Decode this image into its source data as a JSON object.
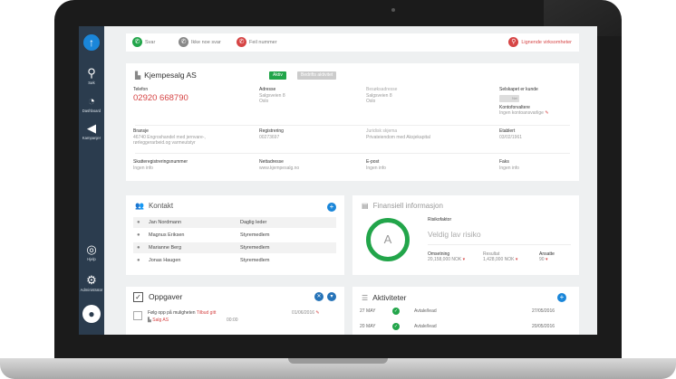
{
  "topbar": {
    "answer": "Svar",
    "no_answer": "Ikke noe svar",
    "wrong_number": "Feil nummer",
    "similar": "Lignende virksomheter"
  },
  "sidebar": {
    "search": "Søk",
    "dashboard": "Dashboard",
    "campaigns": "Kampanjer",
    "help": "Hjelp",
    "admin": "Administrator"
  },
  "company": {
    "name": "Kjempesalg AS",
    "status": "Aktiv",
    "status2": "Bedrifts aktivitet",
    "phone_label": "Telefon",
    "phone": "02920 668790",
    "address_label": "Adresse",
    "address1": "Salgsveien 8",
    "address2": "Oslo",
    "business_address_label": "Besøksadresse",
    "business_address1": "Salgsveien 8",
    "business_address2": "Oslo",
    "is_customer_label": "Selskapet er kunde",
    "is_customer_value": "Nei",
    "account_manager_label": "Kontoforvaltere",
    "account_manager_value": "Ingen kontoansvarlige",
    "industry_label": "Bransje",
    "industry_value1": "46740 Engroshandel med jernvare-,",
    "industry_value2": "rørleggerarbeid.og varmeutstyr",
    "registration_label": "Registrering",
    "registration_value": "00273697",
    "legal_form_label": "Juridisk skjema",
    "legal_form_value": "Privateiendom med Aksjekapital",
    "established_label": "Etablert",
    "established_value": "03/02/1961",
    "tax_label": "Skatteregistreringsnummer",
    "tax_value": "Ingen info",
    "website_label": "Nettadresse",
    "website_value": "www.kjempesalg.no",
    "email_label": "E-post",
    "email_value": "Ingen info",
    "fax_label": "Faks",
    "fax_value": "Ingen info"
  },
  "contacts": {
    "title": "Kontakt",
    "rows": [
      {
        "name": "Jan Nordmann",
        "role": "Daglig leder"
      },
      {
        "name": "Magnus Eriksen",
        "role": "Styremedlem"
      },
      {
        "name": "Marianne Berg",
        "role": "Styremedlem"
      },
      {
        "name": "Jonas Haugen",
        "role": "Styremedlem"
      }
    ]
  },
  "finance": {
    "title": "Finansiell informasjon",
    "grade": "A",
    "risk_label": "Risikofaktor",
    "risk_value": "Veldig lav risiko",
    "turnover_label": "Omsetning",
    "turnover_value": "20,158,000 NOK",
    "result_label": "Resultat",
    "result_value": "1,428,000 NOK",
    "employees_label": "Ansatte",
    "employees_value": "90"
  },
  "tasks": {
    "title": "Oppgaver",
    "item_text": "Følg opp på muligheten",
    "item_link": "Tilbud gitt",
    "item_date": "01/06/2016",
    "item_company": "Salg AS",
    "item_time": "00:00"
  },
  "activities": {
    "title": "Aktiviteter",
    "rows": [
      {
        "day": "27 MAY",
        "type": "Avtale/lead",
        "date": "27/05/2016"
      },
      {
        "day": "20 MAY",
        "type": "Avtale/lead",
        "date": "20/05/2016"
      }
    ]
  },
  "colors": {
    "accent": "#1a86d9",
    "green": "#22a54a",
    "red": "#d64545",
    "sidebar": "#2b3c4e"
  }
}
